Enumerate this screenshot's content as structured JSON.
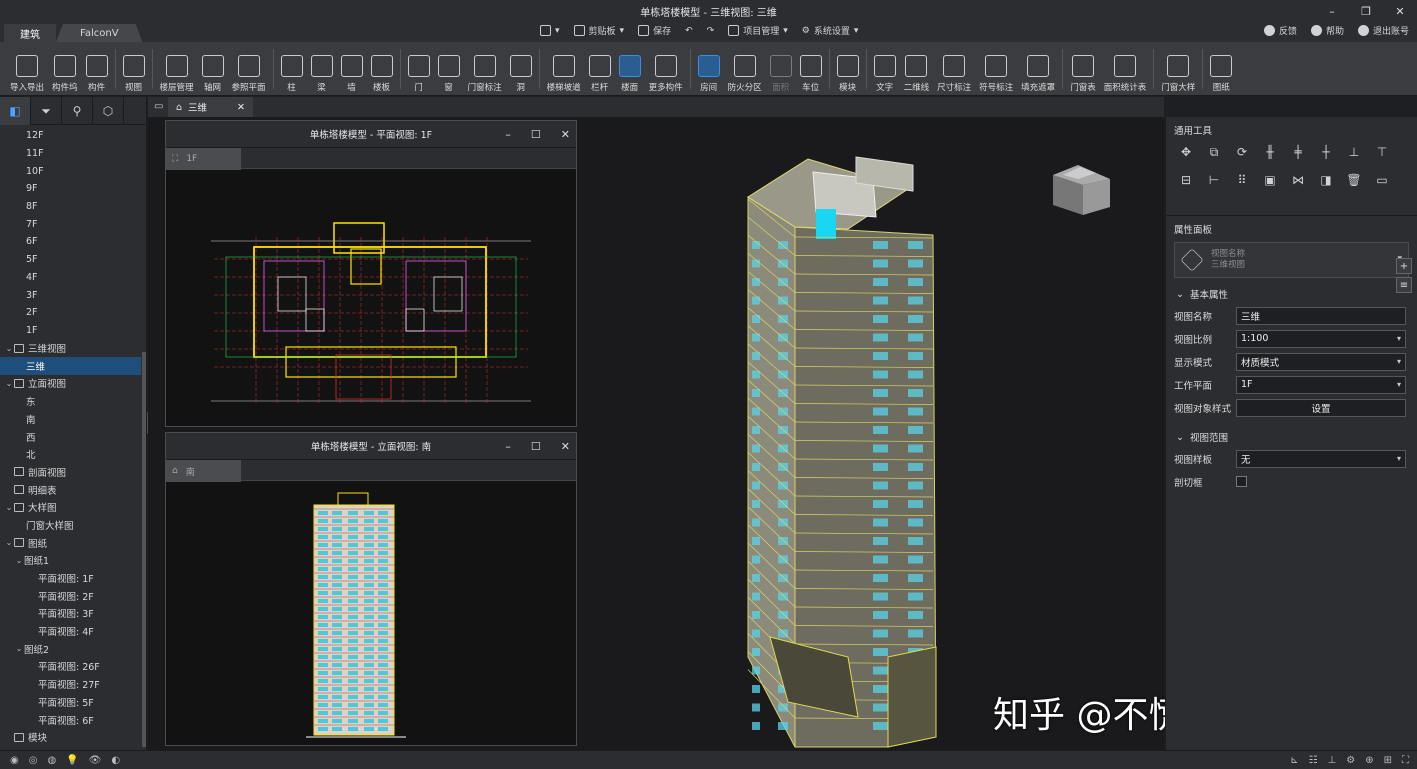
{
  "window": {
    "title": "单栋塔楼模型 - 三维视图: 三维"
  },
  "tabs": [
    {
      "label": "建筑"
    },
    {
      "label": "FalconV"
    }
  ],
  "quickbar": {
    "clipboard": "剪贴板",
    "save": "保存",
    "project_manage": "项目管理",
    "system_settings": "系统设置"
  },
  "userlinks": {
    "feedback": "反馈",
    "help": "帮助",
    "logout": "退出账号"
  },
  "ribbon": [
    {
      "label": "导入导出"
    },
    {
      "label": "构件坞"
    },
    {
      "label": "构件"
    },
    {
      "label": "视图"
    },
    {
      "label": "楼层管理"
    },
    {
      "label": "轴网"
    },
    {
      "label": "参照平面"
    },
    {
      "label": "柱"
    },
    {
      "label": "梁"
    },
    {
      "label": "墙"
    },
    {
      "label": "楼板"
    },
    {
      "label": "门"
    },
    {
      "label": "窗"
    },
    {
      "label": "门窗标注"
    },
    {
      "label": "洞"
    },
    {
      "label": "楼梯坡道"
    },
    {
      "label": "栏杆"
    },
    {
      "label": "楼面"
    },
    {
      "label": "更多构件"
    },
    {
      "label": "房间"
    },
    {
      "label": "防火分区"
    },
    {
      "label": "面积"
    },
    {
      "label": "车位"
    },
    {
      "label": "模块"
    },
    {
      "label": "文字"
    },
    {
      "label": "二维线"
    },
    {
      "label": "尺寸标注"
    },
    {
      "label": "符号标注"
    },
    {
      "label": "填充遮罩"
    },
    {
      "label": "门窗表"
    },
    {
      "label": "面积统计表"
    },
    {
      "label": "门窗大样"
    },
    {
      "label": "图纸"
    }
  ],
  "tree": {
    "floors": [
      "12F",
      "11F",
      "10F",
      "9F",
      "8F",
      "7F",
      "6F",
      "5F",
      "4F",
      "3F",
      "2F",
      "1F"
    ],
    "view3d": "三维视图",
    "view3d_item": "三维",
    "elevation": "立面视图",
    "elevations": [
      "东",
      "南",
      "西",
      "北"
    ],
    "section": "剖面视图",
    "schedule": "明细表",
    "detail": "大样图",
    "detail_item": "门窗大样图",
    "sheets": "图纸",
    "sheet1": "图纸1",
    "sheet1_items": [
      "平面视图: 1F",
      "平面视图: 2F",
      "平面视图: 3F",
      "平面视图: 4F"
    ],
    "sheet2": "图纸2",
    "sheet2_items": [
      "平面视图: 26F",
      "平面视图: 27F",
      "平面视图: 5F",
      "平面视图: 6F"
    ],
    "module": "模块"
  },
  "doc_tab": {
    "label": "三维"
  },
  "plan_window": {
    "title": "单栋塔楼模型 - 平面视图: 1F",
    "tab": "1F"
  },
  "elev_window": {
    "title": "单栋塔楼模型 - 立面视图: 南",
    "tab": "南"
  },
  "right": {
    "tools_title": "通用工具",
    "props_title": "属性面板",
    "prop_header": {
      "line1": "视图名称",
      "line2": "三维视图"
    },
    "basic_section": "基本属性",
    "fields": [
      {
        "key": "视图名称",
        "value": "三维"
      },
      {
        "key": "视图比例",
        "value": "1:100"
      },
      {
        "key": "显示模式",
        "value": "材质模式"
      },
      {
        "key": "工作平面",
        "value": "1F"
      },
      {
        "key": "视图对象样式",
        "value": "设置"
      }
    ],
    "range_section": "视图范围",
    "template": {
      "key": "视图样板",
      "value": "无"
    },
    "cutbox": {
      "key": "剖切框"
    }
  },
  "watermark": "知乎 @不慌不急不躁"
}
